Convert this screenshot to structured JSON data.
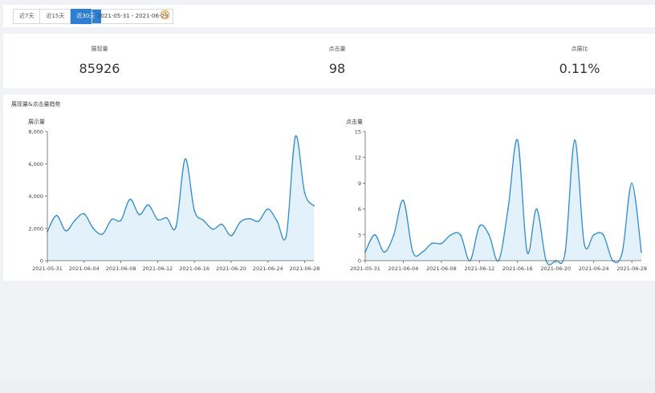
{
  "toolbar": {
    "range_buttons": [
      "近7天",
      "近15天",
      "近30天"
    ],
    "active_index": 2,
    "date_range": "2021-05-31 - 2021-06-29",
    "help_icon": "?"
  },
  "stats": [
    {
      "label": "展现量",
      "value": "85926"
    },
    {
      "label": "点击量",
      "value": "98"
    },
    {
      "label": "点展比",
      "value": "0.11%"
    }
  ],
  "charts_title": "展现量&点击量趋势",
  "colors": {
    "line": "#2e8ccf",
    "fill": "#e3f1fb",
    "active": "#2d7fd3"
  },
  "chart_data": [
    {
      "type": "area",
      "title": "",
      "ylabel": "展示量",
      "xlabel": "",
      "ylim": [
        0,
        8000
      ],
      "yticks": [
        0,
        2000,
        4000,
        6000,
        8000
      ],
      "ytick_labels": [
        "0",
        "2,000",
        "4,000",
        "6,000",
        "8,000"
      ],
      "x": [
        "2021-05-31",
        "2021-06-01",
        "2021-06-02",
        "2021-06-03",
        "2021-06-04",
        "2021-06-05",
        "2021-06-06",
        "2021-06-07",
        "2021-06-08",
        "2021-06-09",
        "2021-06-10",
        "2021-06-11",
        "2021-06-12",
        "2021-06-13",
        "2021-06-14",
        "2021-06-15",
        "2021-06-16",
        "2021-06-17",
        "2021-06-18",
        "2021-06-19",
        "2021-06-20",
        "2021-06-21",
        "2021-06-22",
        "2021-06-23",
        "2021-06-24",
        "2021-06-25",
        "2021-06-26",
        "2021-06-27",
        "2021-06-28",
        "2021-06-29"
      ],
      "xtick_labels": [
        "2021-05-31",
        "2021-06-04",
        "2021-06-08",
        "2021-06-12",
        "2021-06-16",
        "2021-06-20",
        "2021-06-24",
        "2021-06-28"
      ],
      "xtick_every": 4,
      "values": [
        1800,
        2800,
        1850,
        2500,
        2900,
        2000,
        1650,
        2550,
        2500,
        3800,
        2850,
        3450,
        2550,
        2650,
        2100,
        6300,
        3100,
        2500,
        1950,
        2250,
        1550,
        2400,
        2600,
        2450,
        3200,
        2450,
        1550,
        7700,
        4200,
        3400
      ]
    },
    {
      "type": "area",
      "title": "",
      "ylabel": "点击量",
      "xlabel": "",
      "ylim": [
        0,
        15
      ],
      "yticks": [
        0,
        3,
        6,
        9,
        12,
        15
      ],
      "ytick_labels": [
        "0",
        "3",
        "6",
        "9",
        "12",
        "15"
      ],
      "x": [
        "2021-05-31",
        "2021-06-01",
        "2021-06-02",
        "2021-06-03",
        "2021-06-04",
        "2021-06-05",
        "2021-06-06",
        "2021-06-07",
        "2021-06-08",
        "2021-06-09",
        "2021-06-10",
        "2021-06-11",
        "2021-06-12",
        "2021-06-13",
        "2021-06-14",
        "2021-06-15",
        "2021-06-16",
        "2021-06-17",
        "2021-06-18",
        "2021-06-19",
        "2021-06-20",
        "2021-06-21",
        "2021-06-22",
        "2021-06-23",
        "2021-06-24",
        "2021-06-25",
        "2021-06-26",
        "2021-06-27",
        "2021-06-28",
        "2021-06-29"
      ],
      "xtick_labels": [
        "2021-05-31",
        "2021-06-04",
        "2021-06-08",
        "2021-06-12",
        "2021-06-16",
        "2021-06-20",
        "2021-06-24",
        "2021-06-28"
      ],
      "xtick_every": 4,
      "values": [
        1,
        3,
        1,
        3,
        7,
        1,
        1,
        2,
        2,
        3,
        3,
        0,
        4,
        3,
        0,
        6,
        14,
        1,
        6,
        0,
        0,
        1,
        14,
        2,
        3,
        3,
        0,
        1,
        9,
        1
      ]
    }
  ]
}
